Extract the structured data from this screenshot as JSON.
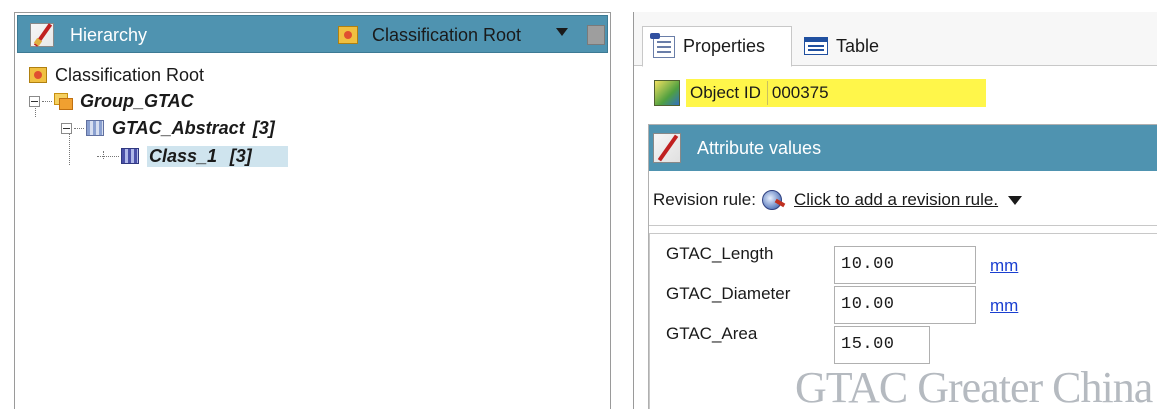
{
  "hierarchy": {
    "title": "Hierarchy",
    "root_selector_label": "Classification Root",
    "tree": {
      "root": "Classification Root",
      "group": "Group_GTAC",
      "abstract": "GTAC_Abstract",
      "abstract_count": "[3]",
      "class": "Class_1",
      "class_count": "[3]"
    }
  },
  "tabs": {
    "properties": "Properties",
    "table": "Table"
  },
  "object": {
    "id_label": "Object ID",
    "id_value": "000375"
  },
  "attributes": {
    "title": "Attribute values",
    "revision_rule_label": "Revision rule:",
    "revision_rule_link": "Click to add a revision rule.",
    "rows": [
      {
        "name": "GTAC_Length",
        "value": "10.00",
        "unit": "mm"
      },
      {
        "name": "GTAC_Diameter",
        "value": "10.00",
        "unit": "mm"
      },
      {
        "name": "GTAC_Area",
        "value": "15.00",
        "unit": ""
      }
    ]
  },
  "watermark": "GTAC Greater China",
  "colors": {
    "header_blue": "#4f93b0",
    "selection": "#cfe4ee",
    "highlight_yellow": "#fff64a",
    "link_blue": "#1a3fd0"
  }
}
